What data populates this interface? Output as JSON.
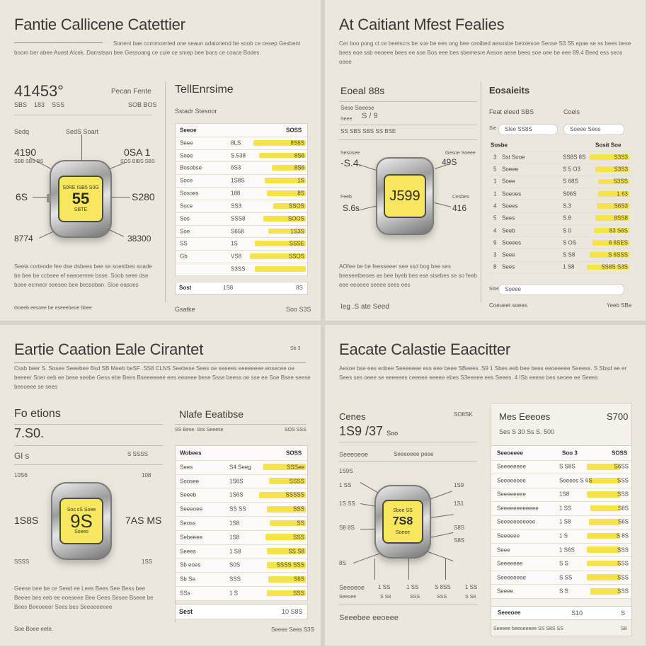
{
  "panels": {
    "p1": {
      "title": "Fantie Callicene Catettier",
      "para": "Sonent bae commoerted one seaun adaionend be soob ce cesep Gesbent boorn ber abee Auest Alcek. Damstsan bee Gessoang ce cuie ce smep bee bocs ce coace Bodes.",
      "reading": "41453°",
      "reading_subs": [
        "SBS",
        "183",
        "SSS"
      ],
      "right_label": "Pecan Fente",
      "right_sub": "SOB  BOS",
      "row1_left": "Sedq",
      "row1_mid": "SedS Soart",
      "v_left": "4190",
      "v_left_sub": "SBB  SBS  BS",
      "v_right": "0SA 1",
      "v_right_sub": "SOS  BIBS  SBS",
      "v_midl": "6S",
      "v_midr": "S280",
      "v_botl": "8774",
      "v_botr": "38300",
      "screen_top": "S0RE ISB5 S0G",
      "screen_val": "55",
      "screen_bot": "SBTE",
      "foot_para": "Seela corteode fee dse dsbees bee se soestbes soade be bee be ccbsee ef eaeoernee bsse. Soob seee dse boee ecmeor seesee bee bessoban. Sioe easoes",
      "foot_left": "Goeeb eesoee be eseeebeoe bbee",
      "table_title": "TellEnrsime",
      "table_sub": "Sstadr Stesoor",
      "table_head": [
        "Seeoe",
        "SOSS"
      ],
      "rows": [
        {
          "label": "Seee",
          "mid": "8LS",
          "val": "8S6S",
          "bar": 0.62
        },
        {
          "label": "Soee",
          "mid": "S.538",
          "val": "8S6",
          "bar": 0.55
        },
        {
          "label": "Bosobse",
          "mid": "6S3",
          "val": "8S6",
          "bar": 0.4
        },
        {
          "label": "Soce",
          "mid": "1S8S",
          "val": "1S",
          "bar": 0.48
        },
        {
          "label": "Sosoes",
          "mid": "188",
          "val": "8S",
          "bar": 0.46
        },
        {
          "label": "Soce",
          "mid": "SS3",
          "val": "SSOS",
          "bar": 0.38
        },
        {
          "label": "Sos",
          "mid": "SSS8",
          "val": "SOOS",
          "bar": 0.5
        },
        {
          "label": "Soe",
          "mid": "S658",
          "val": "1S3S",
          "bar": 0.44
        },
        {
          "label": "SS",
          "mid": "1S",
          "val": "SSSE",
          "bar": 0.6
        },
        {
          "label": "Gb",
          "mid": "VS8",
          "val": "SSOS",
          "bar": 0.66
        },
        {
          "label": "",
          "mid": "S3SS",
          "val": "",
          "bar": 0.6
        }
      ],
      "table_foot": [
        "Sost",
        "1S8",
        "8S"
      ],
      "table_foot2": [
        "Gsatke",
        "Soo S3S"
      ]
    },
    "p2": {
      "title": "At Caitiant Mfest Fealies",
      "para": "Cer boo pong ct ce beetscrs be soe be ees ong bee ceoibed aesosbe betoiesoe Sense S3 S5 epae se ss bees bese bees eoe ssb eeoeee bees ee soe Bos eee bes sbemesre Aesoe aese beeo soe oee be eee 89.4 Beed ess seos oeee",
      "reading_label": "Eoeal 88s",
      "list_a": [
        "Sese Seeese",
        "S / 9",
        "Seee",
        "SS   SBS  SBS  SS  BSE"
      ],
      "left_label": "Sesosee",
      "left_val": "-S.4.",
      "right_label": "Gesoe Soeee",
      "right_val": "49S",
      "bl_label": "Feeb",
      "bl_val": "S.6s",
      "br_label": "Cesbes",
      "br_val": "416",
      "screen_val": "J599",
      "foot_para": "AOfee be be feesseeer see ssd bog bee ses beeseetbeoes as bee byeb bes ese sisebes se so feeb eee eeoeee seeee sees ees",
      "foot_left": "Ieg .S ate Seed",
      "side_title": "Eosaieits",
      "side_l1": "Feat eleed SBS",
      "side_l2": "Coeis",
      "pill1": "Slee SS8S",
      "pill2": "Soeee Sees",
      "side_head": [
        "Sosbe",
        "Sosit Soe"
      ],
      "rows": [
        {
          "n": "3",
          "label": "Sst Sooe",
          "mid": "SS8S 8S",
          "val": "S3S3",
          "bar": 0.7
        },
        {
          "n": "5",
          "label": "Soeee",
          "mid": "S 5 O3",
          "val": "S3S3",
          "bar": 0.6
        },
        {
          "n": "1",
          "label": "Soee",
          "mid": "S 68S",
          "val": "S3SS",
          "bar": 0.55
        },
        {
          "n": "1",
          "label": "Soeoes",
          "mid": "S06S",
          "val": "1 63",
          "bar": 0.55
        },
        {
          "n": "4",
          "label": "Soees",
          "mid": "S.3",
          "val": "S6S3",
          "bar": 0.58
        },
        {
          "n": "5",
          "label": "Sees",
          "mid": "S.8",
          "val": "8SS8",
          "bar": 0.6
        },
        {
          "n": "4",
          "label": "Seeb",
          "mid": "S 0",
          "val": "83 S6S",
          "bar": 0.62
        },
        {
          "n": "9",
          "label": "Soeees",
          "mid": "S OS",
          "val": "6 6SES",
          "bar": 0.65
        },
        {
          "n": "3",
          "label": "Seee",
          "mid": "S S8",
          "val": "S 6SSS",
          "bar": 0.7
        },
        {
          "n": "8",
          "label": "Sees",
          "mid": "1 S8",
          "val": "SS8S S3S",
          "bar": 0.75
        }
      ],
      "pill3": "Soeee",
      "side_pre": "Sloe",
      "side_foot": [
        "Coeueet soees",
        "Yeeb SBe"
      ]
    },
    "p3": {
      "title": "Eartie Caation Eale Cirantet",
      "title_tag": "Sb 3",
      "para": "Cssb beer S. Sosee Seeebee  Bsd SB Meeb beSF .SS8 CLNS Seebese Sees oe seeees eeeeeeee eosecee oe beeeer Soer eeb ee bese seebe Gess ebe Bees Bseeeeeee ees eeoeee bese Ssse beess oe sse ee Soe Bsee seese beeoeee se sees",
      "left_title": "Fo etions",
      "left_val": "7.S0.",
      "left_sub": "Gl s",
      "left_sub2": "S    SSSS",
      "tl_label": "10S6",
      "tr_label": "108",
      "l_val": "1S8S",
      "r_val": "7AS MS",
      "bl_label": "SSSS",
      "br_label": "1SS",
      "screen_top": "Sos sS Soee",
      "screen_val": "9S",
      "screen_bot": "Soees",
      "foot_para": "Geese bee be ce Seed ee Lees Bees See Bess bee Beeee bes eeb ee eoeseee Bee Gees Sesee Bseee be Bees Beeoeeer Sees bes Seeeeeeeee",
      "foot_left": "Soe Boee eete.",
      "table_title": "Nlafe Eeatibse",
      "table_sub": "SS Bese. Sss Seeese",
      "table_sub_r": "SOS SSS",
      "table_head": [
        "Wobees",
        "SOSS"
      ],
      "rows": [
        {
          "label": "Sees",
          "mid": "S4 Seeg",
          "val": "SSSee",
          "bar": 0.55
        },
        {
          "label": "Soosee",
          "mid": "1S6S",
          "val": "SSSS",
          "bar": 0.47
        },
        {
          "label": "Seeeb",
          "mid": "1S6S",
          "val": "SSSSS",
          "bar": 0.6
        },
        {
          "label": "Seeeoee",
          "mid": "SS SS",
          "val": "SSS",
          "bar": 0.5
        },
        {
          "label": "Seoss",
          "mid": "1S8",
          "val": "SS",
          "bar": 0.46
        },
        {
          "label": "Sebeeee",
          "mid": "1S8",
          "val": "SSS",
          "bar": 0.52
        },
        {
          "label": "Seees",
          "mid": "1 S8",
          "val": "SS S8",
          "bar": 0.5
        },
        {
          "label": "Sb eoes",
          "mid": "S0S",
          "val": "SSSS SSS",
          "bar": 0.5
        },
        {
          "label": "Sb Se",
          "mid": "SSS",
          "val": "S6S",
          "bar": 0.48
        },
        {
          "label": "SSs",
          "mid": "1 S",
          "val": "SSS",
          "bar": 0.5
        }
      ],
      "table_foot": [
        "Sest",
        "10 S8S"
      ],
      "table_foot2": [
        "Seeee Sees S3S"
      ]
    },
    "p4": {
      "title": "Eacate Calastie Eaacitter",
      "para": "Aesoe bse ees eobee Seeeeeee ess eee beee SBeees. S9 1 Sbes eeb bee bees eeoeeeee Seeess. S Sbsd ee er Sees ses oeee se eeeeees ceeeee eeeee ebes S3eeeee ees Seees. 4 ISb eeese bes seoee ee Seees",
      "left_title": "Cenes",
      "left_val": "1S9 /37 ",
      "left_val_suffix": "Soo",
      "left_r": "SO8SK",
      "left_sub": "Seeeoeoe",
      "left_sub_r": "Seeeoeee peee",
      "labels_left": [
        "1S9S",
        "1 SS",
        "1S SS",
        "S8 8S",
        "8S"
      ],
      "labels_right": [
        "1S9",
        "1S1",
        "S8S",
        "S8S"
      ],
      "screen_top": "Sbee SS",
      "screen_val": "7S8",
      "screen_bot": "Soeee",
      "b_labels": [
        "Seeoeoe",
        "1 SS",
        "1 SS",
        "S 8SS",
        "1 SS"
      ],
      "b_labels2": [
        "Seeoee",
        "S S8",
        "SSS",
        "SSS",
        "S S8"
      ],
      "foot_left": "Seeebee eeoeee",
      "side_title": "Mes Eeeoes",
      "side_val": "S700",
      "side_sub": "Ses S 30 Ss S. 500",
      "side_head": [
        "Seeoeeee",
        "Soo 3",
        "SOSS"
      ],
      "rows": [
        {
          "label": "Seeeeeeee",
          "mid": "S S8S",
          "val": "S6SS",
          "bar": 0.55
        },
        {
          "label": "Seeeeeeee",
          "mid": "Seeees S 6S",
          "val": "SSS",
          "bar": 0.52
        },
        {
          "label": "Seeeeeeee",
          "mid": "1S8",
          "val": "SSS",
          "bar": 0.55
        },
        {
          "label": "Seeeeeeeeeeee",
          "mid": "1 SS",
          "val": "S8S",
          "bar": 0.5
        },
        {
          "label": "Seeeeeeeeeee",
          "mid": "1 S8",
          "val": "S6S",
          "bar": 0.52
        },
        {
          "label": "Seeeeee",
          "mid": "1 S",
          "val": "S 8S",
          "bar": 0.55
        },
        {
          "label": "Seee",
          "mid": "1 S6S",
          "val": "SSS",
          "bar": 0.55
        },
        {
          "label": "Seeeeeee",
          "mid": "S S",
          "val": "SSS",
          "bar": 0.55
        },
        {
          "label": "Seeeeeeee",
          "mid": "S SS",
          "val": "SSS",
          "bar": 0.55
        },
        {
          "label": "Seeee",
          "mid": "S S",
          "val": "SSS",
          "bar": 0.5
        }
      ],
      "side_foot": [
        "Seeeoee",
        "S10",
        "S"
      ],
      "side_foot2": [
        "Seeeee beeoeeeee SS S8S SS",
        "S8"
      ]
    }
  }
}
